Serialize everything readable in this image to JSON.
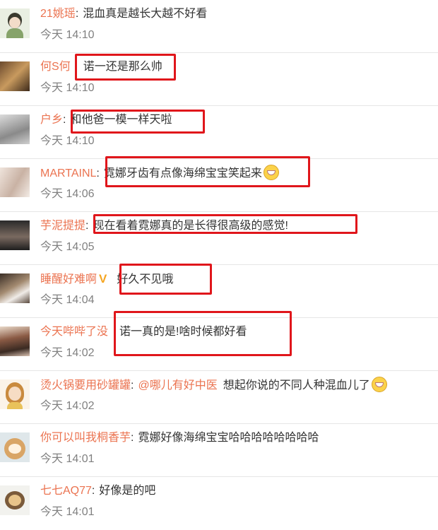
{
  "comments": [
    {
      "user": "21姚瑶",
      "text": "混血真是越长大越不好看",
      "time": "今天 14:10"
    },
    {
      "user": "何S何",
      "text": "诺一还是那么帅",
      "time": "今天 14:10"
    },
    {
      "user": "户乡",
      "text": "和他爸一模一样天啦",
      "time": "今天 14:10"
    },
    {
      "user": "MARTAINL",
      "text": "霓娜牙齿有点像海绵宝宝笑起来",
      "time": "今天 14:06"
    },
    {
      "user": "芋泥提提",
      "text": "现在看着霓娜真的是长得很高级的感觉!",
      "time": "今天 14:05"
    },
    {
      "user": "睡醒好难啊",
      "text": "好久不见哦",
      "time": "今天 14:04"
    },
    {
      "user": "今天哔哔了没",
      "text": "诺一真的是!啥时候都好看",
      "time": "今天 14:02"
    },
    {
      "user": "烫火锅要用砂罐罐",
      "mention": "@哪儿有好中医",
      "text": "想起你说的不同人种混血儿了",
      "time": "今天 14:02"
    },
    {
      "user": "你可以叫我桐香芋",
      "text": "霓娜好像海绵宝宝哈哈哈哈哈哈哈哈",
      "time": "今天 14:01"
    },
    {
      "user": "七七AQ77",
      "text": "好像是的吧",
      "time": "今天 14:01"
    }
  ],
  "icons": {
    "laugh": "grinning-emoji-icon",
    "verified": "verified-v-icon"
  },
  "colors": {
    "username": "#eb7350",
    "highlight": "#e0161b",
    "time": "#808080"
  }
}
